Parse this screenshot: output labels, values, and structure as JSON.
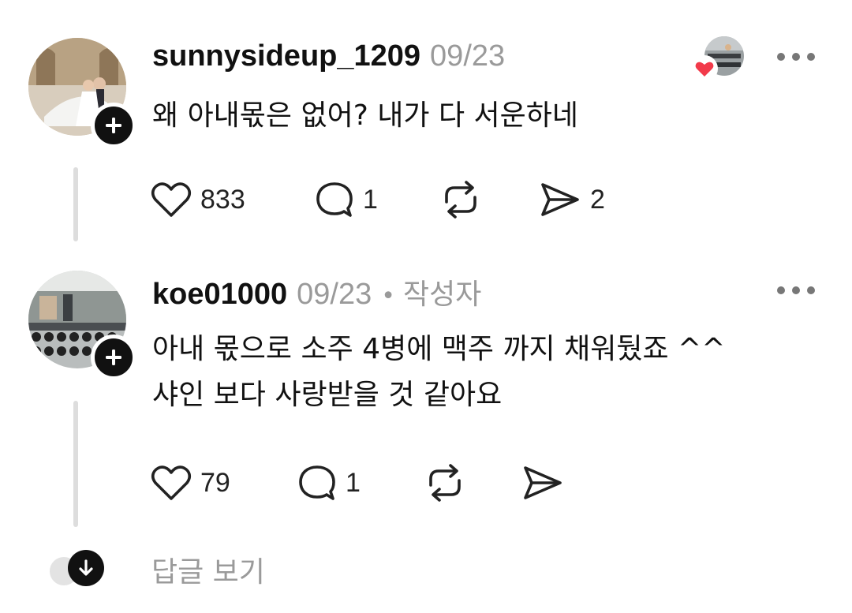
{
  "posts": [
    {
      "username": "sunnysideup_1209",
      "date": "09/23",
      "author_tag": "",
      "text_lines": [
        "왜 아내몫은 없어? 내가 다 서운하네"
      ],
      "likes": "833",
      "replies": "1",
      "shares": "2",
      "liked_by_author": true
    },
    {
      "username": "koe01000",
      "date": "09/23",
      "separator": "•",
      "author_tag": "작성자",
      "text_lines": [
        "아내 몫으로 소주 4병에 맥주 까지  채워뒀죠 ^^",
        "샤인 보다 사랑받을 것 같아요"
      ],
      "likes": "79",
      "replies": "1",
      "shares": ""
    }
  ],
  "footer": {
    "view_replies_label": "답글 보기"
  },
  "icons": {
    "follow": "plus-icon",
    "more": "more-options-icon",
    "like": "heart-icon",
    "reply": "comment-icon",
    "repost": "repost-icon",
    "share": "send-icon",
    "expand": "arrow-down-icon"
  },
  "colors": {
    "heart_badge": "#f23a4a",
    "muted_text": "#9a9a9a",
    "thread_line": "#dddddd"
  }
}
